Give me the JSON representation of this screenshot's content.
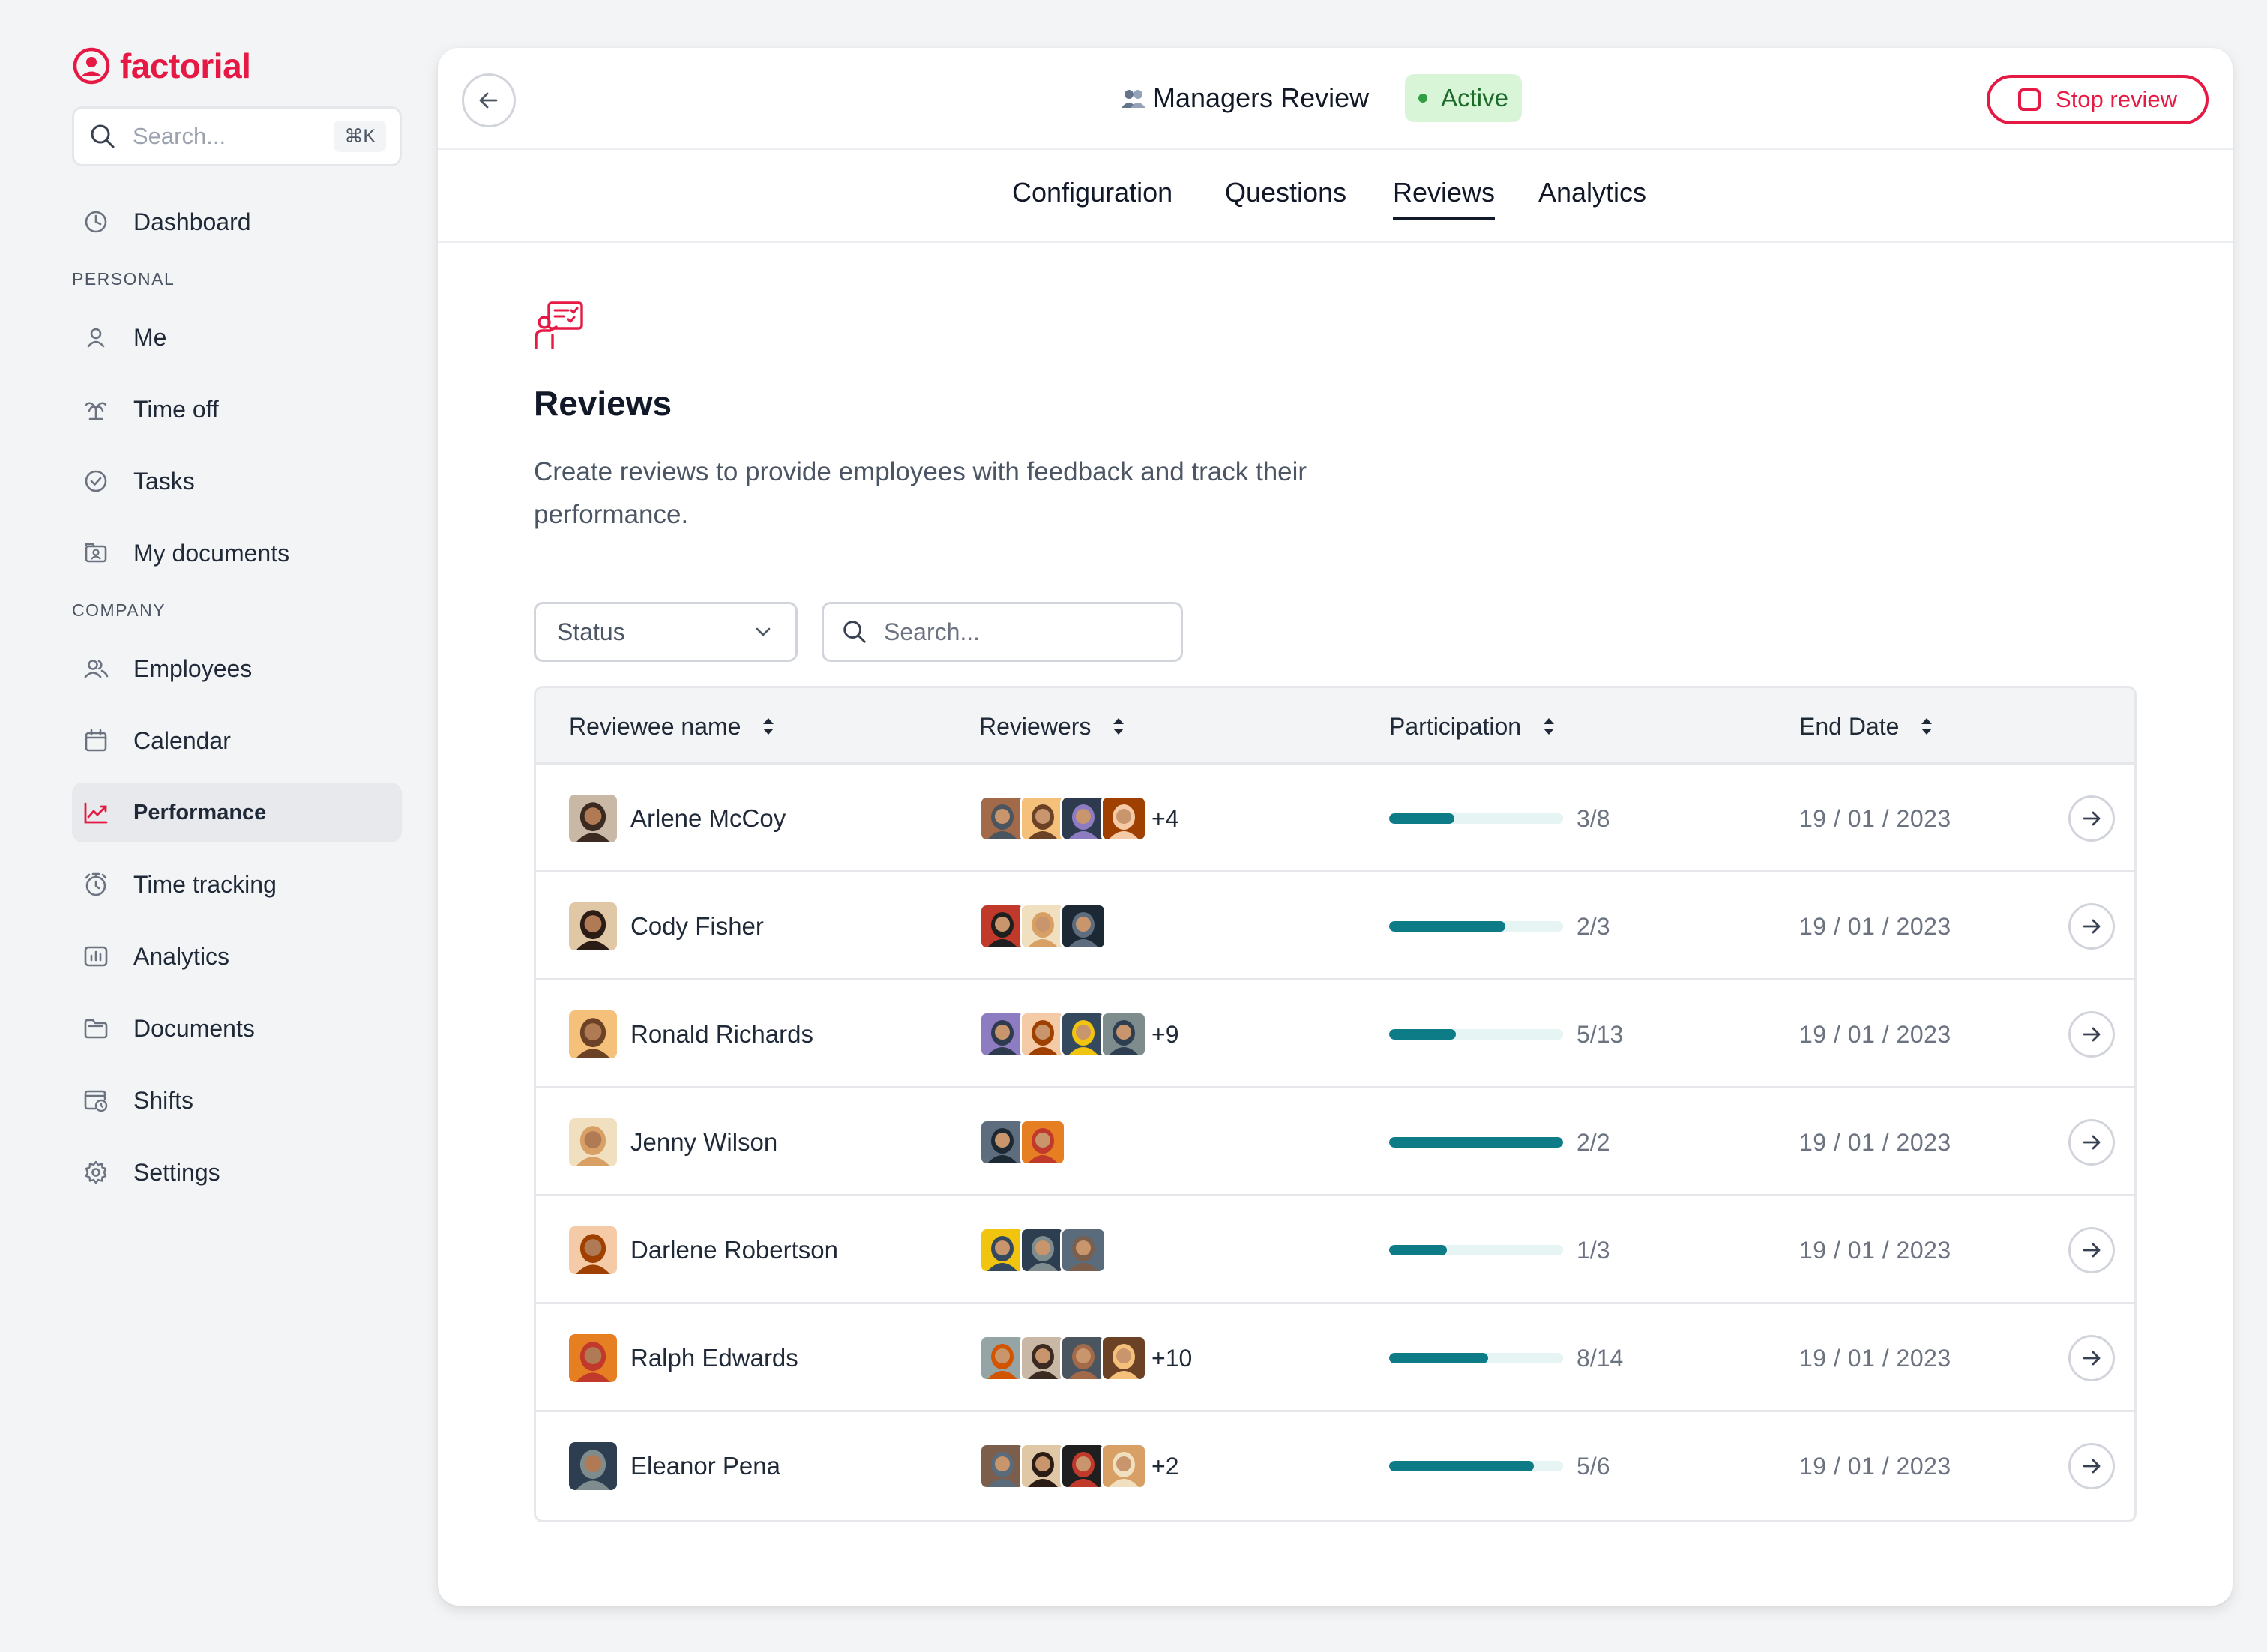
{
  "brand": {
    "name": "factorial",
    "color": "#e51943"
  },
  "sidebar": {
    "search_placeholder": "Search...",
    "search_shortcut": "⌘K",
    "dashboard": {
      "label": "Dashboard",
      "icon": "clock-icon"
    },
    "personal_heading": "PERSONAL",
    "personal": [
      {
        "label": "Me",
        "icon": "user-icon"
      },
      {
        "label": "Time off",
        "icon": "palm-tree-icon"
      },
      {
        "label": "Tasks",
        "icon": "check-circle-icon"
      },
      {
        "label": "My documents",
        "icon": "document-user-icon"
      }
    ],
    "company_heading": "COMPANY",
    "company": [
      {
        "label": "Employees",
        "icon": "users-icon"
      },
      {
        "label": "Calendar",
        "icon": "calendar-icon"
      },
      {
        "label": "Performance",
        "icon": "trend-chart-icon",
        "active": true
      },
      {
        "label": "Time tracking",
        "icon": "stopwatch-icon"
      },
      {
        "label": "Analytics",
        "icon": "bar-chart-icon"
      },
      {
        "label": "Documents",
        "icon": "folder-icon"
      },
      {
        "label": "Shifts",
        "icon": "calendar-clock-icon"
      },
      {
        "label": "Settings",
        "icon": "gear-icon"
      }
    ]
  },
  "header": {
    "title": "Managers Review",
    "status": "Active",
    "stop_label": "Stop review"
  },
  "tabs": [
    "Configuration",
    "Questions",
    "Reviews",
    "Analytics"
  ],
  "active_tab": "Reviews",
  "section": {
    "title": "Reviews",
    "description": "Create reviews to provide employees with feedback and track their performance."
  },
  "filters": {
    "status_label": "Status",
    "search_placeholder": "Search..."
  },
  "table": {
    "columns": [
      "Reviewee name",
      "Reviewers",
      "Participation",
      "End Date"
    ],
    "rows": [
      {
        "name": "Arlene McCoy",
        "reviewers_shown": 4,
        "extra": "+4",
        "done": 3,
        "total": 8,
        "ratio": "3/8",
        "date": "19 / 01 / 2023"
      },
      {
        "name": "Cody Fisher",
        "reviewers_shown": 3,
        "extra": "",
        "done": 2,
        "total": 3,
        "ratio": "2/3",
        "date": "19 / 01 / 2023"
      },
      {
        "name": "Ronald Richards",
        "reviewers_shown": 4,
        "extra": "+9",
        "done": 5,
        "total": 13,
        "ratio": "5/13",
        "date": "19 / 01 / 2023"
      },
      {
        "name": "Jenny Wilson",
        "reviewers_shown": 2,
        "extra": "",
        "done": 2,
        "total": 2,
        "ratio": "2/2",
        "date": "19 / 01 / 2023"
      },
      {
        "name": "Darlene Robertson",
        "reviewers_shown": 3,
        "extra": "",
        "done": 1,
        "total": 3,
        "ratio": "1/3",
        "date": "19 / 01 / 2023"
      },
      {
        "name": "Ralph Edwards",
        "reviewers_shown": 4,
        "extra": "+10",
        "done": 8,
        "total": 14,
        "ratio": "8/14",
        "date": "19 / 01 / 2023"
      },
      {
        "name": "Eleanor Pena",
        "reviewers_shown": 4,
        "extra": "+2",
        "done": 5,
        "total": 6,
        "ratio": "5/6",
        "date": "19 / 01 / 2023"
      }
    ]
  }
}
